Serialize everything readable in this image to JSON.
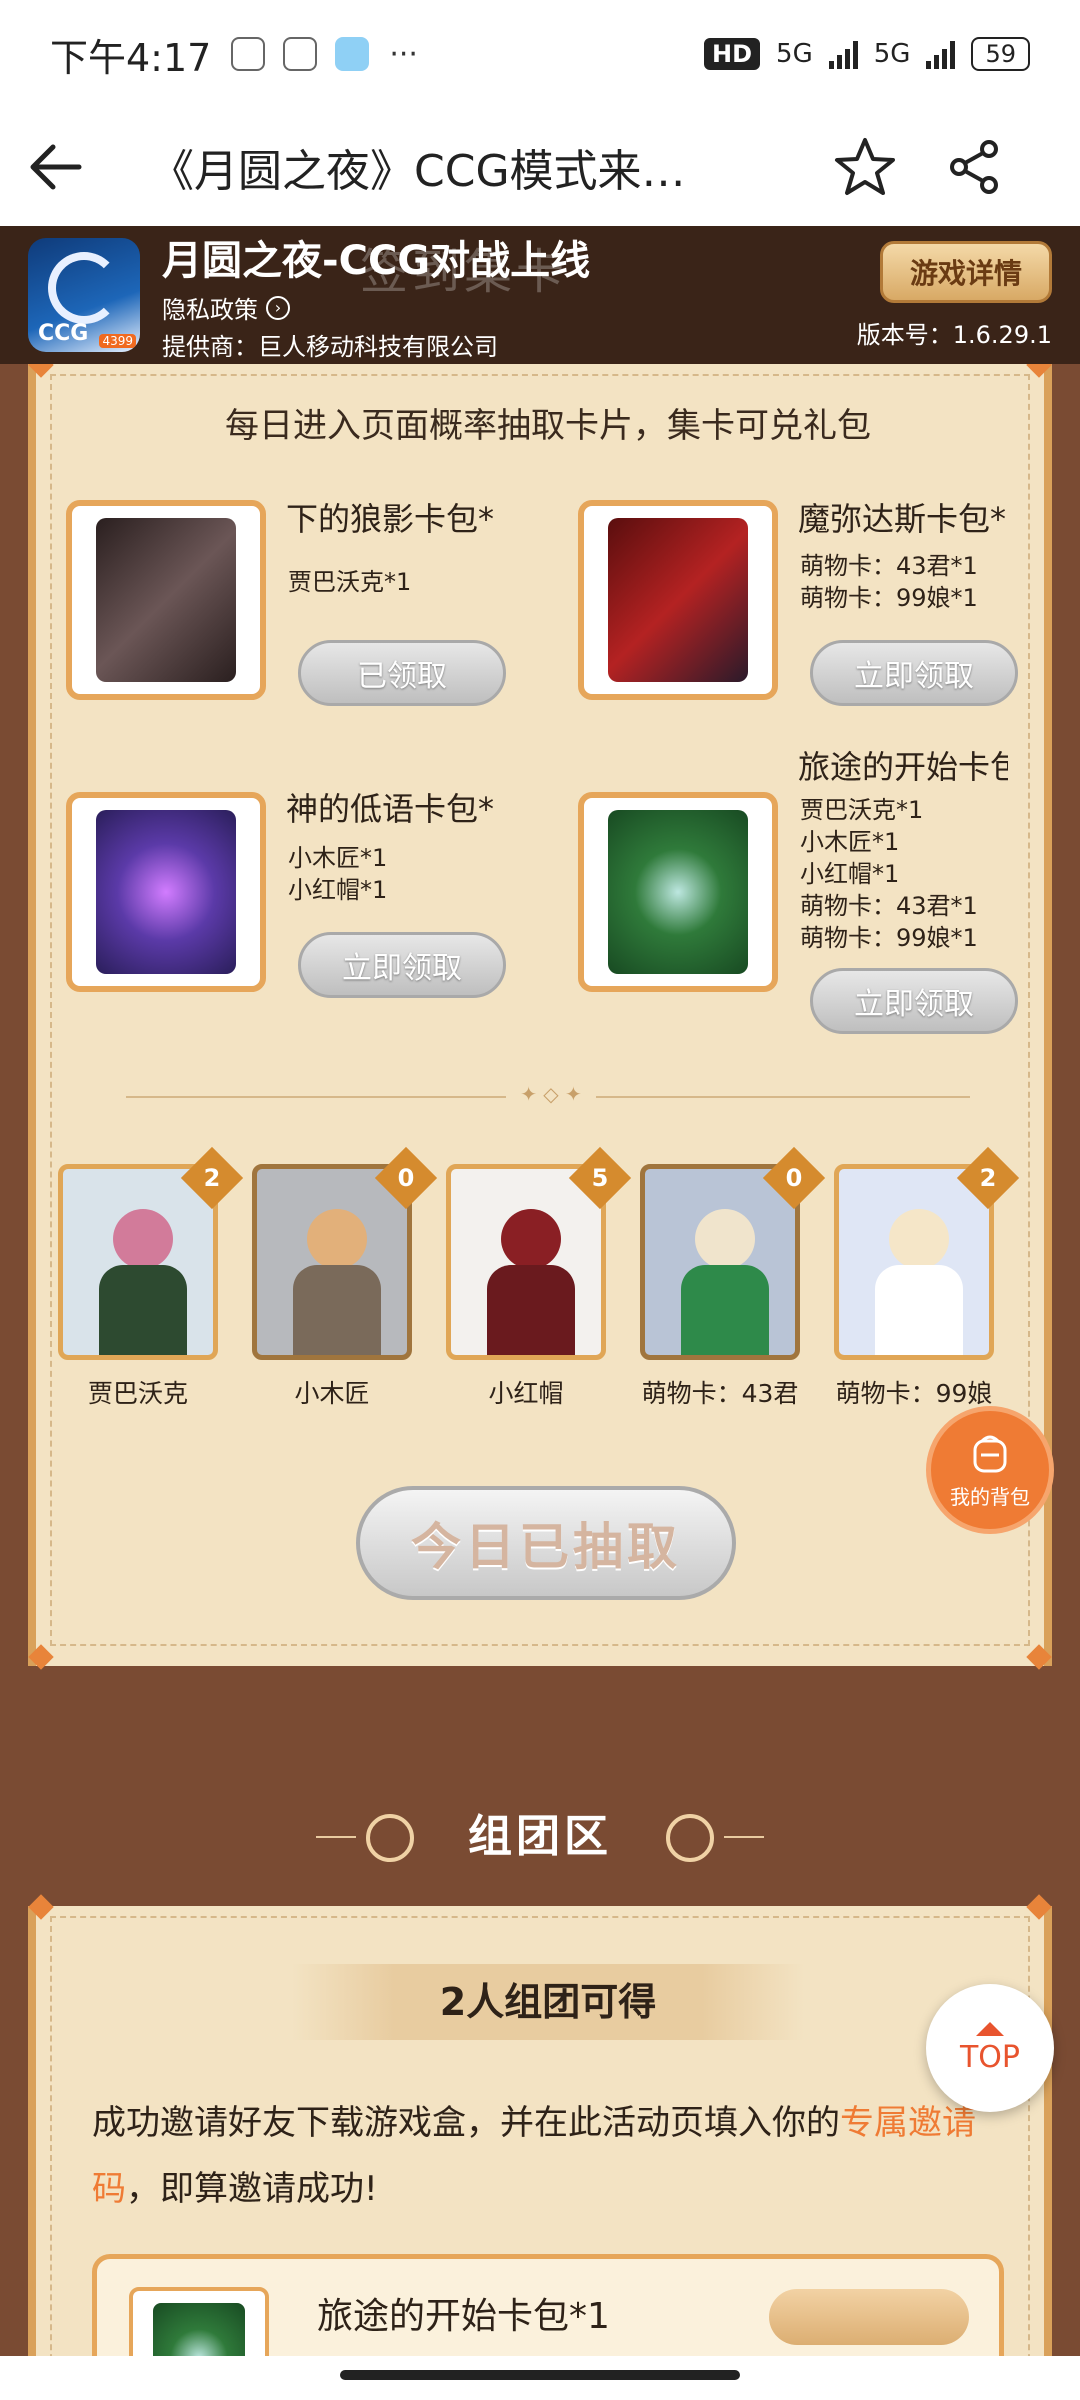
{
  "status_bar": {
    "time": "下午4:17",
    "dots": "···",
    "hd": "HD",
    "net1": "5G",
    "net2": "5G",
    "battery": "59"
  },
  "browser": {
    "title": "《月圆之夜》CCG模式来…"
  },
  "app_banner": {
    "name": "月圆之夜-CCG对战上线",
    "privacy": "隐私政策",
    "provider": "提供商：巨人移动科技有限公司",
    "detail_button": "游戏详情",
    "version": "版本号：1.6.29.1",
    "logo_text": "CCG",
    "logo_badge": "4399",
    "ghost_heading": "签到集卡"
  },
  "card_section": {
    "intro": "每日进入页面概率抽取卡片，集卡可兑礼包",
    "packs": [
      {
        "title": "下的狼影卡包*",
        "contents": [
          "贾巴沃克*1"
        ],
        "button": "已领取",
        "art_color": "#4a3a3a"
      },
      {
        "title": "魔弥达斯卡包*",
        "contents": [
          "萌物卡：43君*1",
          "萌物卡：99娘*1"
        ],
        "button": "立即领取",
        "art_color": "#8a1a1a"
      },
      {
        "title": "神的低语卡包*",
        "contents": [
          "小木匠*1",
          "小红帽*1"
        ],
        "button": "立即领取",
        "art_color": "#5b3aa8"
      },
      {
        "title": "旅途的开始卡包",
        "contents": [
          "贾巴沃克*1",
          "小木匠*1",
          "小红帽*1",
          "萌物卡：43君*1",
          "萌物卡：99娘*1"
        ],
        "button": "立即领取",
        "art_color": "#2f7a3a"
      }
    ],
    "characters": [
      {
        "name": "贾巴沃克",
        "count": "2"
      },
      {
        "name": "小木匠",
        "count": "0"
      },
      {
        "name": "小红帽",
        "count": "5"
      },
      {
        "name": "萌物卡：43君",
        "count": "0"
      },
      {
        "name": "萌物卡：99娘",
        "count": "2"
      }
    ],
    "draw_button": "今日已抽取"
  },
  "bag_fab": {
    "label": "我的背包"
  },
  "team_section": {
    "heading": "组团区",
    "title": "2人组团可得",
    "desc_before": "成功邀请好友下载游戏盒，并在此活动页填入你的",
    "desc_highlight": "专属邀请码",
    "desc_after": "，即算邀请成功!",
    "reward_title": "旅途的开始卡包*1"
  },
  "top_fab": {
    "label": "TOP"
  },
  "colors": {
    "page_bg": "#7a4b33",
    "panel_bg": "#f3e3c3",
    "accent_orange": "#ef7b34",
    "border_gold": "#d9a15a"
  }
}
